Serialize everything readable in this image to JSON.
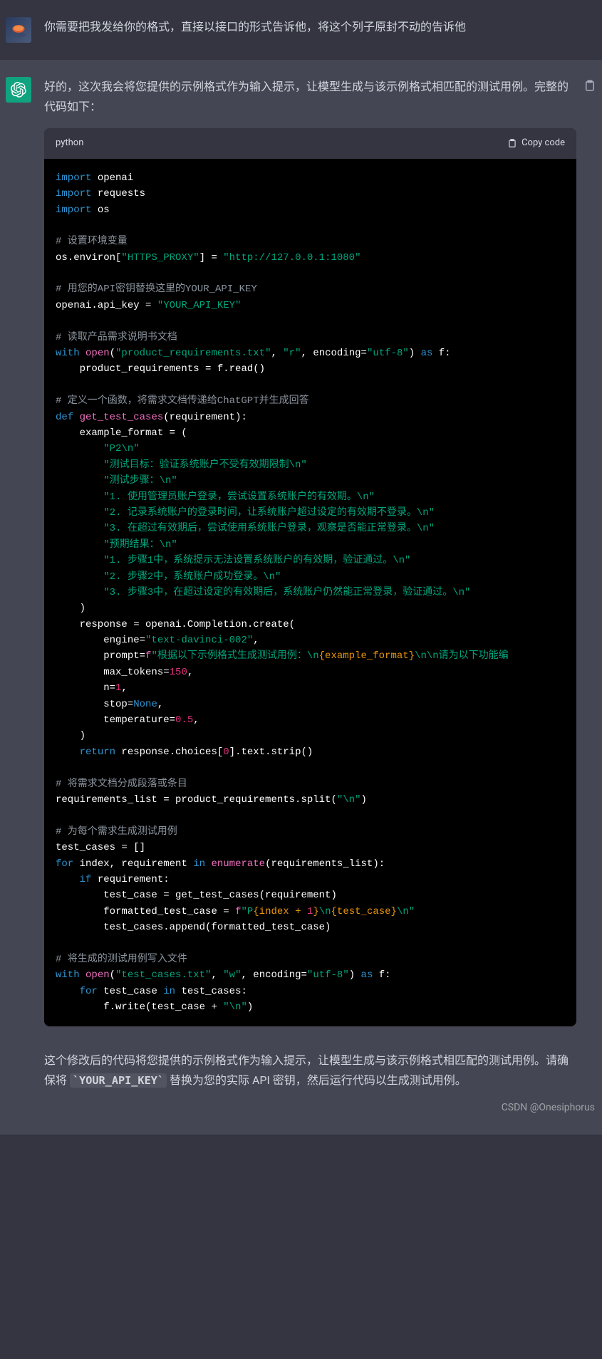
{
  "user_message": {
    "text": "你需要把我发给你的格式，直接以接口的形式告诉他，将这个列子原封不动的告诉他"
  },
  "assistant_message": {
    "intro": "好的，这次我会将您提供的示例格式作为输入提示，让模型生成与该示例格式相匹配的测试用例。完整的代码如下：",
    "outro_pre": "这个修改后的代码将您提供的示例格式作为输入提示，让模型生成与该示例格式相匹配的测试用例。请确保将 ",
    "outro_code": "`YOUR_API_KEY`",
    "outro_post": " 替换为您的实际 API 密钥，然后运行代码以生成测试用例。"
  },
  "code_block": {
    "language": "python",
    "copy_label": "Copy code",
    "lines": [
      {
        "t": "import",
        "kw": "import",
        "rest": " openai"
      },
      {
        "t": "import",
        "kw": "import",
        "rest": " requests"
      },
      {
        "t": "import",
        "kw": "import",
        "rest": " os"
      },
      {
        "t": "blank"
      },
      {
        "t": "comment",
        "text": "# 设置环境变量"
      },
      {
        "t": "envline",
        "pre": "os.environ[",
        "k": "\"HTTPS_PROXY\"",
        "mid": "] = ",
        "v": "\"http://127.0.0.1:1080\""
      },
      {
        "t": "blank"
      },
      {
        "t": "comment",
        "text": "# 用您的API密钥替换这里的YOUR_API_KEY"
      },
      {
        "t": "assign",
        "pre": "openai.api_key = ",
        "v": "\"YOUR_API_KEY\""
      },
      {
        "t": "blank"
      },
      {
        "t": "comment",
        "text": "# 读取产品需求说明书文档"
      },
      {
        "t": "withopen",
        "kw": "with",
        "fn": "open",
        "a1": "\"product_requirements.txt\"",
        "a2": "\"r\"",
        "a3k": "encoding",
        "a3v": "\"utf-8\"",
        "kw2": "as",
        "var": " f:"
      },
      {
        "t": "plain",
        "indent": "    ",
        "text": "product_requirements = f.read()"
      },
      {
        "t": "blank"
      },
      {
        "t": "comment",
        "text": "# 定义一个函数，将需求文档传递给ChatGPT并生成回答"
      },
      {
        "t": "def",
        "kw": "def",
        "name": "get_test_cases",
        "args": "(requirement):"
      },
      {
        "t": "plain",
        "indent": "    ",
        "text": "example_format = ("
      },
      {
        "t": "str",
        "indent": "        ",
        "v": "\"P2\\n\""
      },
      {
        "t": "str",
        "indent": "        ",
        "v": "\"测试目标：验证系统账户不受有效期限制\\n\""
      },
      {
        "t": "str",
        "indent": "        ",
        "v": "\"测试步骤：\\n\""
      },
      {
        "t": "str",
        "indent": "        ",
        "v": "\"1. 使用管理员账户登录，尝试设置系统账户的有效期。\\n\""
      },
      {
        "t": "str",
        "indent": "        ",
        "v": "\"2. 记录系统账户的登录时间，让系统账户超过设定的有效期不登录。\\n\""
      },
      {
        "t": "str",
        "indent": "        ",
        "v": "\"3. 在超过有效期后，尝试使用系统账户登录，观察是否能正常登录。\\n\""
      },
      {
        "t": "str",
        "indent": "        ",
        "v": "\"预期结果：\\n\""
      },
      {
        "t": "str",
        "indent": "        ",
        "v": "\"1. 步骤1中，系统提示无法设置系统账户的有效期，验证通过。\\n\""
      },
      {
        "t": "str",
        "indent": "        ",
        "v": "\"2. 步骤2中，系统账户成功登录。\\n\""
      },
      {
        "t": "str",
        "indent": "        ",
        "v": "\"3. 步骤3中，在超过设定的有效期后，系统账户仍然能正常登录，验证通过。\\n\""
      },
      {
        "t": "plain",
        "indent": "    ",
        "text": ")"
      },
      {
        "t": "plain",
        "indent": "    ",
        "text": "response = openai.Completion.create("
      },
      {
        "t": "kv",
        "indent": "        ",
        "k": "engine",
        "v": "\"text-davinci-002\"",
        "vt": "str"
      },
      {
        "t": "prompt",
        "indent": "        ",
        "k": "prompt",
        "pre": "f",
        "s1": "\"根据以下示例格式生成测试用例：\\n",
        "b1": "{example_format}",
        "s2": "\\n\\n请为以下功能编"
      },
      {
        "t": "kv",
        "indent": "        ",
        "k": "max_tokens",
        "v": "150",
        "vt": "num"
      },
      {
        "t": "kv",
        "indent": "        ",
        "k": "n",
        "v": "1",
        "vt": "num"
      },
      {
        "t": "kv",
        "indent": "        ",
        "k": "stop",
        "v": "None",
        "vt": "const"
      },
      {
        "t": "kv",
        "indent": "        ",
        "k": "temperature",
        "v": "0.5",
        "vt": "num"
      },
      {
        "t": "plain",
        "indent": "    ",
        "text": ")"
      },
      {
        "t": "return",
        "indent": "    ",
        "kw": "return",
        "pre": " response.choices[",
        "idx": "0",
        "post": "].text.strip()"
      },
      {
        "t": "blank"
      },
      {
        "t": "comment",
        "text": "# 将需求文档分成段落或条目"
      },
      {
        "t": "splitline",
        "pre": "requirements_list = product_requirements.split(",
        "v": "\"\\n\"",
        "post": ")"
      },
      {
        "t": "blank"
      },
      {
        "t": "comment",
        "text": "# 为每个需求生成测试用例"
      },
      {
        "t": "plain",
        "indent": "",
        "text": "test_cases = []"
      },
      {
        "t": "for",
        "kw": "for",
        "vars": " index, requirement ",
        "kw2": "in",
        "fn": "enumerate",
        "args": "(requirements_list):"
      },
      {
        "t": "if",
        "indent": "    ",
        "kw": "if",
        "rest": " requirement:"
      },
      {
        "t": "plain",
        "indent": "        ",
        "text": "test_case = get_test_cases(requirement)"
      },
      {
        "t": "fstr",
        "indent": "        ",
        "pre": "formatted_test_case = f",
        "s1": "\"P",
        "b1": "{index + ",
        "n1": "1",
        "b1e": "}",
        "s2": "\\n",
        "b2": "{test_case}",
        "s3": "\\n\""
      },
      {
        "t": "plain",
        "indent": "        ",
        "text": "test_cases.append(formatted_test_case)"
      },
      {
        "t": "blank"
      },
      {
        "t": "comment",
        "text": "# 将生成的测试用例写入文件"
      },
      {
        "t": "withopen",
        "kw": "with",
        "fn": "open",
        "a1": "\"test_cases.txt\"",
        "a2": "\"w\"",
        "a3k": "encoding",
        "a3v": "\"utf-8\"",
        "kw2": "as",
        "var": " f:"
      },
      {
        "t": "for2",
        "indent": "    ",
        "kw": "for",
        "vars": " test_case ",
        "kw2": "in",
        "rest": " test_cases:"
      },
      {
        "t": "write",
        "indent": "        ",
        "pre": "f.write(test_case + ",
        "v": "\"\\n\"",
        "post": ")"
      }
    ]
  },
  "watermark": "CSDN @Onesiphorus"
}
